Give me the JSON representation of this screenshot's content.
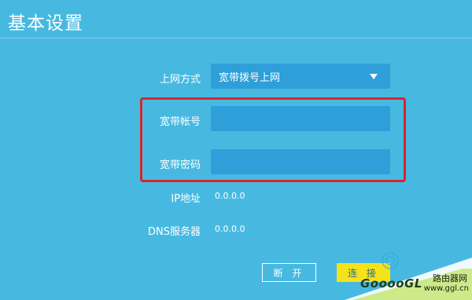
{
  "page": {
    "title": "基本设置"
  },
  "form": {
    "connection_type_label": "上网方式",
    "connection_type_value": "宽带拨号上网",
    "account_label": "宽带帐号",
    "account_value": "",
    "password_label": "宽带密码",
    "password_value": "",
    "ip_label": "IP地址",
    "ip_value": "0.0.0.0",
    "dns_label": "DNS服务器",
    "dns_value": "0.0.0.0"
  },
  "buttons": {
    "disconnect": "断 开",
    "connect": "连 接"
  },
  "watermark": {
    "logo": "GooooGL",
    "site_cn": "路由器网",
    "url": "www.ggl.cn"
  },
  "colors": {
    "background": "#47b9e1",
    "field": "#2e9fd8",
    "highlight": "#d8242c",
    "connect_button": "#f6e21a"
  }
}
